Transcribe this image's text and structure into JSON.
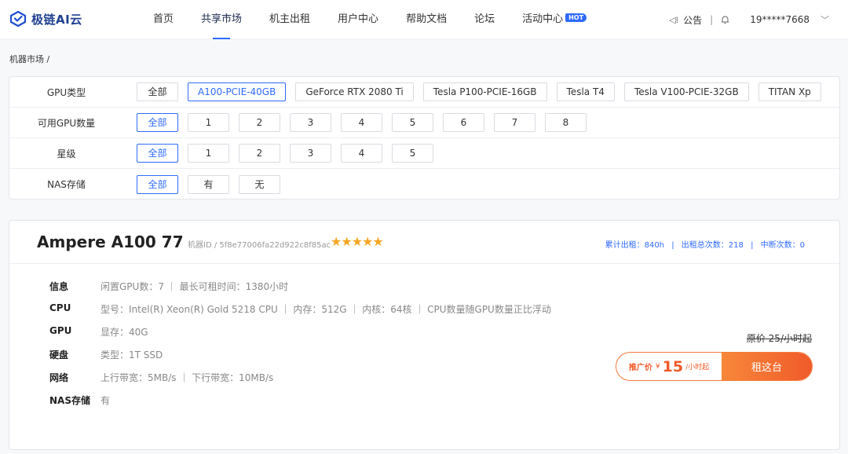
{
  "header": {
    "logo_text": "极链AI云",
    "nav": [
      {
        "label": "首页"
      },
      {
        "label": "共享市场"
      },
      {
        "label": "机主出租"
      },
      {
        "label": "用户中心"
      },
      {
        "label": "帮助文档"
      },
      {
        "label": "论坛"
      },
      {
        "label": "活动中心"
      }
    ],
    "hot_badge": "HOT",
    "announcement": "公告",
    "separator": "|",
    "user": "19*****7668"
  },
  "breadcrumb": "机器市场 /",
  "filters": [
    {
      "label": "GPU类型",
      "options": [
        "全部",
        "A100-PCIE-40GB",
        "GeForce RTX 2080 Ti",
        "Tesla P100-PCIE-16GB",
        "Tesla T4",
        "Tesla V100-PCIE-32GB",
        "TITAN Xp"
      ],
      "selected": "A100-PCIE-40GB"
    },
    {
      "label": "可用GPU数量",
      "options": [
        "全部",
        "1",
        "2",
        "3",
        "4",
        "5",
        "6",
        "7",
        "8"
      ],
      "selected": "全部"
    },
    {
      "label": "星级",
      "options": [
        "全部",
        "1",
        "2",
        "3",
        "4",
        "5"
      ],
      "selected": "全部"
    },
    {
      "label": "NAS存储",
      "options": [
        "全部",
        "有",
        "无"
      ],
      "selected": "全部"
    }
  ],
  "machine": {
    "title": "Ampere A100 77",
    "machine_id": "机器ID / 5f8e77006fa22d922c8f85ac",
    "rating": 5,
    "stars": "★★★★★",
    "stats": {
      "total_rent": "累计出租：840h",
      "rent_count": "出租总次数：218",
      "interrupt_count": "中断次数：0",
      "sep": "|"
    },
    "specs": [
      {
        "key": "信息",
        "value": "闲置GPU数：7 ｜ 最长可租时间：1380小时"
      },
      {
        "key": "CPU",
        "value": "型号：Intel(R) Xeon(R) Gold 5218 CPU ｜ 内存：512G ｜ 内核：64核 ｜ CPU数量随GPU数量正比浮动"
      },
      {
        "key": "GPU",
        "value": "显存：40G"
      },
      {
        "key": "硬盘",
        "value": "类型：1T SSD"
      },
      {
        "key": "网络",
        "value": "上行带宽：5MB/s ｜ 下行带宽：10MB/s"
      },
      {
        "key": "NAS存储",
        "value": "有"
      }
    ],
    "original_price": "原价 25/小时起",
    "promo_label": "推广价",
    "currency": "¥",
    "promo_price": "15",
    "promo_unit": "/小时起",
    "rent_button": "租这台"
  },
  "colors": {
    "accent": "#2f6bff",
    "price": "#f05a28",
    "star": "#f5a623"
  }
}
